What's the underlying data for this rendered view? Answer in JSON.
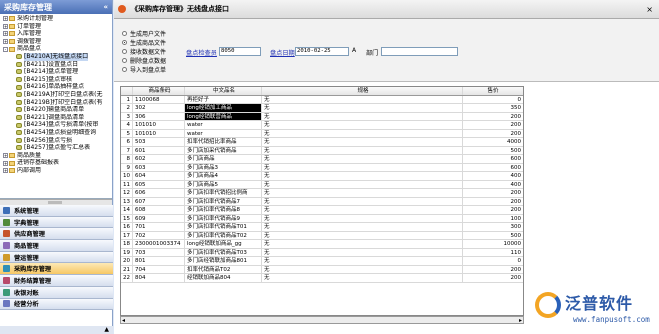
{
  "left_panel": {
    "title": "采购库存管理",
    "collapse_icon": "«",
    "tree": [
      {
        "level": 0,
        "type": "folder",
        "label": "采购计划管理",
        "exp": "+"
      },
      {
        "level": 0,
        "type": "folder",
        "label": "订单管理",
        "exp": "+"
      },
      {
        "level": 0,
        "type": "folder",
        "label": "入库管理",
        "exp": "+"
      },
      {
        "level": 0,
        "type": "folder",
        "label": "调拨管理",
        "exp": "+"
      },
      {
        "level": 0,
        "type": "folder",
        "label": "商品盘点",
        "exp": "-"
      },
      {
        "level": 1,
        "type": "leaf",
        "label": "[B4210A]无线盘点接口",
        "selected": true
      },
      {
        "level": 1,
        "type": "leaf",
        "label": "[B4211]设置盘点日"
      },
      {
        "level": 1,
        "type": "leaf",
        "label": "[B4214]盘点单管理"
      },
      {
        "level": 1,
        "type": "leaf",
        "label": "[B4215]盘点审核"
      },
      {
        "level": 1,
        "type": "leaf",
        "label": "[B4216]单品抽样盘点"
      },
      {
        "level": 1,
        "type": "leaf",
        "label": "[B4219A]打印空白盘点表(无"
      },
      {
        "level": 1,
        "type": "leaf",
        "label": "[B4219B]打印空白盘点表(有"
      },
      {
        "level": 1,
        "type": "leaf",
        "label": "[B4220]输盘商品清单"
      },
      {
        "level": 1,
        "type": "leaf",
        "label": "[B4221]调盘商品清单"
      },
      {
        "level": 1,
        "type": "leaf",
        "label": "[B4234]盘点亏损清单(按审"
      },
      {
        "level": 1,
        "type": "leaf",
        "label": "[B4254]盘点损益明细查询"
      },
      {
        "level": 1,
        "type": "leaf",
        "label": "[B4256]盘点亏损"
      },
      {
        "level": 1,
        "type": "leaf",
        "label": "[B4257]盘点盈亏汇总表"
      },
      {
        "level": 0,
        "type": "folder",
        "label": "商品质量",
        "exp": "+"
      },
      {
        "level": 0,
        "type": "folder",
        "label": "进销存基础报表",
        "exp": "+"
      },
      {
        "level": 0,
        "type": "folder",
        "label": "内部调用",
        "exp": "+"
      }
    ],
    "menus": [
      {
        "label": "系统管理",
        "color": "#3d6fb8"
      },
      {
        "label": "字典管理",
        "color": "#4f8a3c"
      },
      {
        "label": "供应商管理",
        "color": "#c6542d"
      },
      {
        "label": "商品管理",
        "color": "#8c6bb8"
      },
      {
        "label": "营运管理",
        "color": "#d09a2a"
      },
      {
        "label": "采购库存管理",
        "color": "#2f8fb6",
        "active": true
      },
      {
        "label": "财务结算管理",
        "color": "#b84a6b"
      },
      {
        "label": "收银对账",
        "color": "#3c9a77"
      },
      {
        "label": "经营分析",
        "color": "#6a77c0"
      }
    ],
    "bottom_scroll_arrow": "▲"
  },
  "window": {
    "title": "《采购库存管理》无线盘点接口",
    "close": "×",
    "options": [
      {
        "label": "生成用户文件",
        "checked": false
      },
      {
        "label": "生成商品文件",
        "checked": true
      },
      {
        "label": "接收数据文件",
        "checked": false
      },
      {
        "label": "删除盘点数据",
        "checked": false
      },
      {
        "label": "导入到盘点单",
        "checked": false
      }
    ],
    "form": {
      "checker_label": "盘点检查员",
      "checker_value": "8050",
      "date_label": "盘点日期",
      "date_value": "2010-02-25",
      "date_picker": "A",
      "dept_label": "部门",
      "dept_value": ""
    },
    "grid": {
      "headers": [
        "",
        "商品条码",
        "中文品名",
        "规格",
        "售价"
      ],
      "rows": [
        [
          "1",
          "1100068",
          "再拒好子",
          "无",
          "0"
        ],
        [
          "2",
          "302",
          "long经销加工商品",
          "无",
          "350"
        ],
        [
          "3",
          "306",
          "long经销联营商品",
          "无",
          "200"
        ],
        [
          "4",
          "101010",
          "water",
          "无",
          "200"
        ],
        [
          "5",
          "101010",
          "water",
          "无",
          "200"
        ],
        [
          "6",
          "503",
          "扣率代销招比率商品",
          "无",
          "4000"
        ],
        [
          "7",
          "601",
          "多门店加采代销商品",
          "无",
          "500"
        ],
        [
          "8",
          "602",
          "多门店商品",
          "无",
          "600"
        ],
        [
          "9",
          "603",
          "多门店商品3",
          "无",
          "600"
        ],
        [
          "10",
          "604",
          "多门店商品4",
          "无",
          "400"
        ],
        [
          "11",
          "605",
          "多门店商品5",
          "无",
          "400"
        ],
        [
          "12",
          "606",
          "多门店扣率代销招比例商",
          "无",
          "200"
        ],
        [
          "13",
          "607",
          "多门店扣率代销商品7",
          "无",
          "200"
        ],
        [
          "14",
          "608",
          "多门店扣率代销商品8",
          "无",
          "200"
        ],
        [
          "15",
          "609",
          "多门店扣率代销商品9",
          "无",
          "100"
        ],
        [
          "16",
          "701",
          "多门店扣率代销商品T01",
          "无",
          "300"
        ],
        [
          "17",
          "702",
          "多门店扣率代销商品T02",
          "无",
          "500"
        ],
        [
          "18",
          "2300001003374",
          "long经销联加商品_gg",
          "无",
          "10000"
        ],
        [
          "19",
          "703",
          "多门店扣率代销商品T03",
          "无",
          "110"
        ],
        [
          "20",
          "801",
          "多门店经销联加商品801",
          "无",
          "0"
        ],
        [
          "21",
          "704",
          "扣率代销商品T02",
          "无",
          "200"
        ],
        [
          "22",
          "804",
          "经销联加商品804",
          "无",
          "200"
        ]
      ],
      "highlight_cells": [
        [
          1,
          2
        ],
        [
          2,
          2
        ]
      ]
    }
  },
  "logo": {
    "name": "泛普软件",
    "url": "www.fanpusoft.com"
  }
}
